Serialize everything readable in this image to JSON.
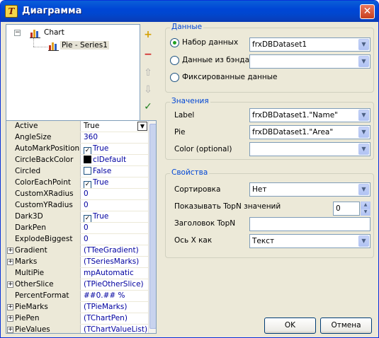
{
  "window": {
    "title": "Диаграмма",
    "app_icon_letter": "T",
    "close_glyph": "✕"
  },
  "tree": {
    "root_label": "Chart",
    "child_label": "Pie - Series1",
    "expander": "−"
  },
  "side_buttons": [
    {
      "icon": "add-series-icon",
      "glyph": "+"
    },
    {
      "icon": "delete-series-icon",
      "glyph": "−"
    },
    {
      "icon": "move-up-icon",
      "glyph": "⇧"
    },
    {
      "icon": "move-down-icon",
      "glyph": "⇩"
    },
    {
      "icon": "edit-series-icon",
      "glyph": "✓"
    }
  ],
  "properties": [
    {
      "name": "Active",
      "value": "True",
      "kind": "dropdown",
      "expandable": false
    },
    {
      "name": "AngleSize",
      "value": "360",
      "kind": "text",
      "expandable": false
    },
    {
      "name": "AutoMarkPosition",
      "value": "True",
      "kind": "check",
      "checked": true,
      "expandable": false
    },
    {
      "name": "CircleBackColor",
      "value": "clDefault",
      "kind": "color",
      "expandable": false
    },
    {
      "name": "Circled",
      "value": "False",
      "kind": "check",
      "checked": false,
      "expandable": false
    },
    {
      "name": "ColorEachPoint",
      "value": "True",
      "kind": "check",
      "checked": true,
      "expandable": false
    },
    {
      "name": "CustomXRadius",
      "value": "0",
      "kind": "text",
      "expandable": false
    },
    {
      "name": "CustomYRadius",
      "value": "0",
      "kind": "text",
      "expandable": false
    },
    {
      "name": "Dark3D",
      "value": "True",
      "kind": "check",
      "checked": true,
      "expandable": false
    },
    {
      "name": "DarkPen",
      "value": "0",
      "kind": "text",
      "expandable": false
    },
    {
      "name": "ExplodeBiggest",
      "value": "0",
      "kind": "text",
      "expandable": false
    },
    {
      "name": "Gradient",
      "value": "(TTeeGradient)",
      "kind": "text",
      "expandable": true
    },
    {
      "name": "Marks",
      "value": "(TSeriesMarks)",
      "kind": "text",
      "expandable": true
    },
    {
      "name": "MultiPie",
      "value": "mpAutomatic",
      "kind": "text",
      "expandable": false
    },
    {
      "name": "OtherSlice",
      "value": "(TPieOtherSlice)",
      "kind": "text",
      "expandable": true
    },
    {
      "name": "PercentFormat",
      "value": "##0.## %",
      "kind": "text",
      "expandable": false
    },
    {
      "name": "PieMarks",
      "value": "(TPieMarks)",
      "kind": "text",
      "expandable": true
    },
    {
      "name": "PiePen",
      "value": "(TChartPen)",
      "kind": "text",
      "expandable": true
    },
    {
      "name": "PieValues",
      "value": "(TChartValueList)",
      "kind": "text",
      "expandable": true
    }
  ],
  "data_group": {
    "legend": "Данные",
    "radio_dataset": "Набор данных",
    "radio_band": "Данные из бэнда",
    "radio_fixed": "Фиксированные данные",
    "dataset_value": "frxDBDataset1",
    "band_value": ""
  },
  "values_group": {
    "legend": "Значения",
    "label_caption": "Label",
    "label_value": "frxDBDataset1.\"Name\"",
    "pie_caption": "Pie",
    "pie_value": "frxDBDataset1.\"Area\"",
    "color_caption": "Color (optional)",
    "color_value": ""
  },
  "props_group": {
    "legend": "Свойства",
    "sort_caption": "Сортировка",
    "sort_value": "Нет",
    "topn_caption": "Показывать TopN значений",
    "topn_value": "0",
    "topn_title_caption": "Заголовок TopN",
    "topn_title_value": "",
    "xaxis_caption": "Ось X как",
    "xaxis_value": "Текст"
  },
  "buttons": {
    "ok": "OK",
    "cancel": "Отмена"
  },
  "colors": {
    "titlebar": "#0046d5",
    "legend": "#0046d5",
    "face": "#ece9d8",
    "prop_value": "#0000a0"
  }
}
